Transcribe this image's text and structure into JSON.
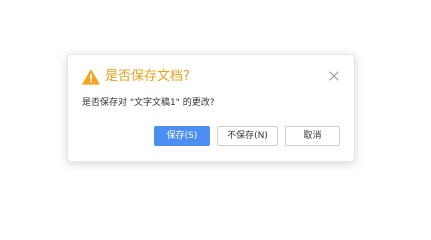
{
  "dialog": {
    "title": "是否保存文档?",
    "message": "是否保存对 \"文字文稿1\" 的更改?",
    "buttons": {
      "save": "保存(S)",
      "dont_save": "不保存(N)",
      "cancel": "取消"
    },
    "icons": {
      "title": "warning-icon",
      "close": "close-icon"
    },
    "colors": {
      "title": "#e8a31c",
      "warning": "#f2a51f",
      "primary_button": "#4d8ef2"
    }
  }
}
